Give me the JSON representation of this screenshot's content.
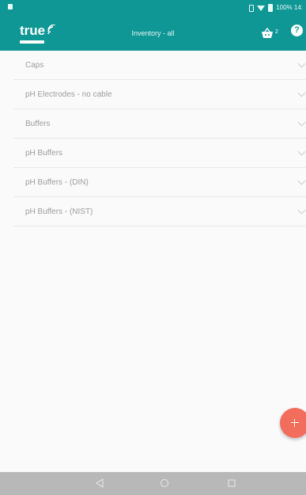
{
  "status_bar": {
    "battery_text": "100% 14:"
  },
  "app_bar": {
    "logo_text": "true",
    "title": "Inventory - all",
    "cart_count": "2",
    "help_label": "?",
    "colors": {
      "primary": "#0f9796",
      "fab": "#f26d5b"
    }
  },
  "icons": {
    "cart": "basket-icon",
    "help": "help-icon",
    "chevron": "chevron-down-icon",
    "fab": "plus-icon",
    "nav_back": "back-triangle-icon",
    "nav_home": "home-circle-icon",
    "nav_recent": "recent-square-icon"
  },
  "list": {
    "items": [
      {
        "label": "Caps"
      },
      {
        "label": "pH Electrodes - no cable"
      },
      {
        "label": "Buffers"
      },
      {
        "label": "pH Buffers"
      },
      {
        "label": "pH Buffers - (DIN)"
      },
      {
        "label": "pH Buffers - (NIST)"
      }
    ]
  }
}
